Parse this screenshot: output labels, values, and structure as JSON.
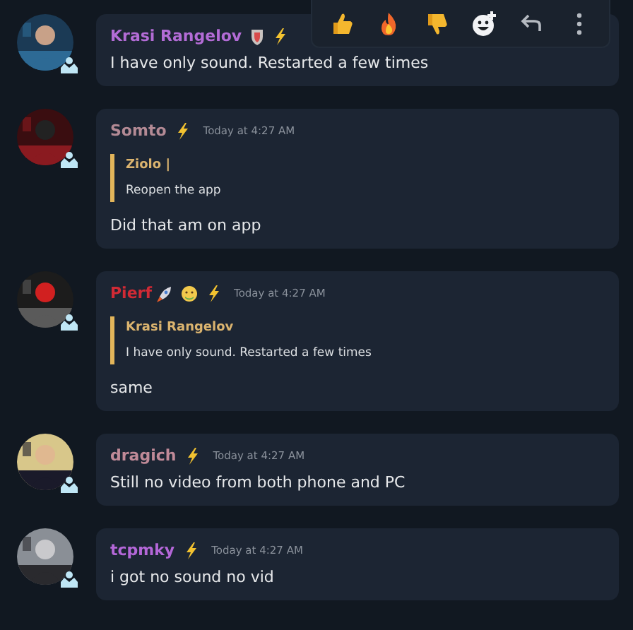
{
  "messages": [
    {
      "author": "Krasi Rangelov",
      "color": "#b36cd6",
      "kind": "moderator",
      "text": "I have only sound. Restarted a few times"
    },
    {
      "author": "Somto",
      "color": "#b38a95",
      "kind": "plain",
      "time": "Today at 4:27 AM",
      "reply": {
        "author": "Ziolo |",
        "text": "Reopen the app"
      },
      "text": "Did that am on app"
    },
    {
      "author": "Pierf",
      "color": "#d02a35",
      "kind": "emoji",
      "time": "Today at 4:27 AM",
      "reply": {
        "author": "Krasi Rangelov",
        "text": "I have only sound. Restarted a few times"
      },
      "text": "same"
    },
    {
      "author": "dragich",
      "color": "#c08a98",
      "kind": "plain",
      "time": "Today at 4:27 AM",
      "text": "Still no video from both phone and PC"
    },
    {
      "author": "tcpmky",
      "color": "#b467d8",
      "kind": "plain",
      "time": "Today at 4:27 AM",
      "text": "i got no sound no vid"
    }
  ],
  "toolbar": {
    "visible": true
  }
}
